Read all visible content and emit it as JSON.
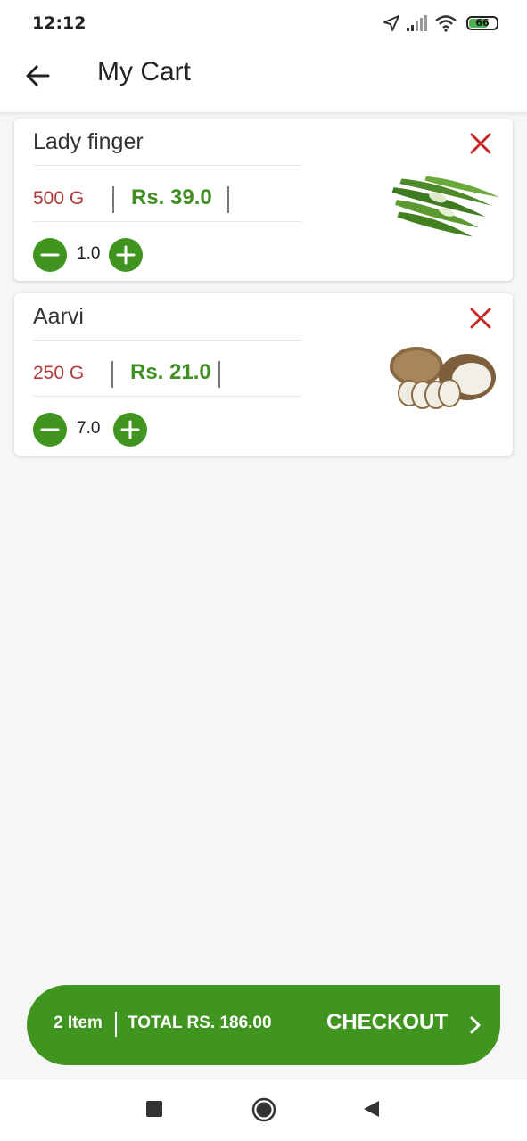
{
  "status_bar": {
    "time": "12:12",
    "battery": "66",
    "icons": [
      "location-icon",
      "signal-icon",
      "wifi-icon",
      "battery-icon"
    ]
  },
  "app_bar": {
    "title": "My Cart",
    "back_icon": "arrow-left-icon"
  },
  "cart": {
    "items": [
      {
        "name": "Lady finger",
        "weight": "500  G",
        "price": "Rs. 39.0",
        "quantity": "1.0"
      },
      {
        "name": "Aarvi",
        "weight": "250  G",
        "price": "Rs. 21.0",
        "quantity": "7.0"
      }
    ]
  },
  "checkout": {
    "items_count": "2 Item",
    "total": "TOTAL  RS. 186.00",
    "button_label": "CHECKOUT"
  },
  "colors": {
    "primary_green": "#3f951f",
    "price_green": "#3f8f22",
    "weight_red": "#b23a3a",
    "remove_red": "#c62828"
  },
  "nav_bar": {
    "icons": [
      "recents-icon",
      "home-icon",
      "back-icon"
    ]
  }
}
